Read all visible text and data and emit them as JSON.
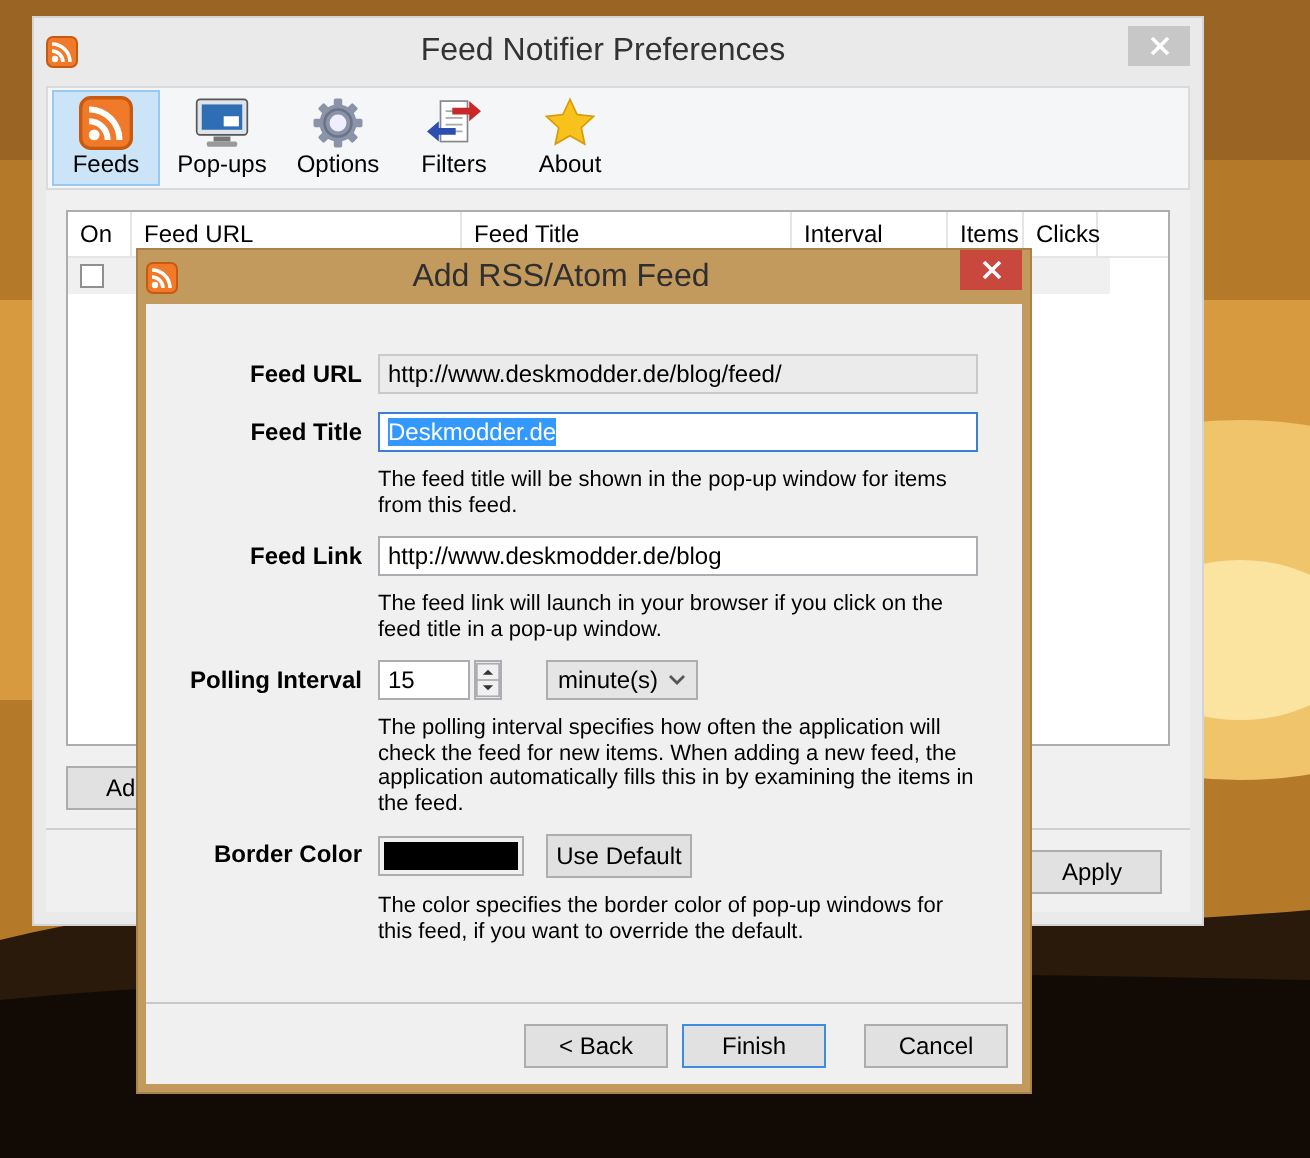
{
  "main_window": {
    "title": "Feed Notifier Preferences",
    "toolbar": [
      {
        "label": "Feeds",
        "selected": true
      },
      {
        "label": "Pop-ups",
        "selected": false
      },
      {
        "label": "Options",
        "selected": false
      },
      {
        "label": "Filters",
        "selected": false
      },
      {
        "label": "About",
        "selected": false
      }
    ],
    "table": {
      "columns": [
        "On",
        "Feed URL",
        "Feed Title",
        "Interval",
        "Items",
        "Clicks"
      ],
      "rows": [
        {
          "on": false
        }
      ]
    },
    "buttons": [
      "Ad",
      "Apply"
    ]
  },
  "dialog": {
    "title": "Add RSS/Atom Feed",
    "fields": [
      {
        "kind": "text",
        "label": "Feed URL",
        "value": "http://www.deskmodder.de/blog/feed/",
        "readonly": true,
        "focused": false
      },
      {
        "kind": "text",
        "label": "Feed Title",
        "value": "Deskmodder.de",
        "readonly": false,
        "focused": true,
        "help": "The feed title will be shown in the pop-up window for items from this feed."
      },
      {
        "kind": "text",
        "label": "Feed Link",
        "value": "http://www.deskmodder.de/blog",
        "readonly": false,
        "focused": false,
        "help": "The feed link will launch in your browser if you click on the feed title in a pop-up window."
      },
      {
        "kind": "interval",
        "label": "Polling Interval",
        "value": "15",
        "unit": "minute(s)",
        "help": "The polling interval specifies how often the application will check the feed for new items. When adding a new feed, the application automatically fills this in by examining the items in the feed."
      },
      {
        "kind": "color",
        "label": "Border Color",
        "color": "#000000",
        "button": "Use Default",
        "help": "The color specifies the border color of pop-up windows for this feed, if you want to override the default."
      }
    ],
    "buttons": [
      {
        "label": "< Back",
        "default": false
      },
      {
        "label": "Finish",
        "default": true
      },
      {
        "label": "Cancel",
        "default": false
      }
    ]
  }
}
